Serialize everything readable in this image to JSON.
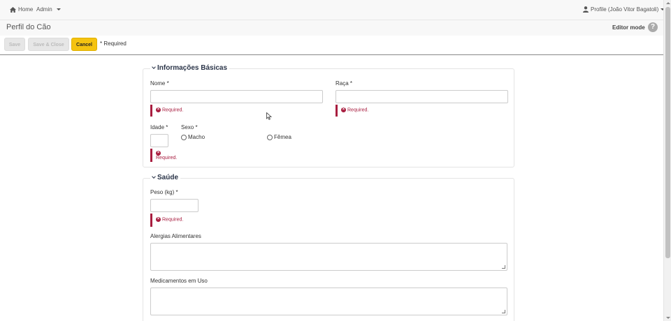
{
  "nav": {
    "home_label": "Home",
    "admin_label": "Admin",
    "profile_label": "Profile (João Vitor Bagatoli)"
  },
  "page": {
    "title": "Perfil do Cão",
    "editor_mode_label": "Editor mode",
    "help_icon": "question-icon"
  },
  "toolbar": {
    "save_label": "Save",
    "save_close_label": "Save & Close",
    "cancel_label": "Cancel",
    "required_note": "* Required"
  },
  "basic_info": {
    "legend": "Informações Básicas",
    "nome_label": "Nome *",
    "nome_value": "",
    "raca_label": "Raça *",
    "raca_value": "",
    "idade_label": "Idade *",
    "idade_value": "",
    "sexo_label": "Sexo *",
    "sexo_options": [
      "Macho",
      "Fêmea"
    ],
    "required_msg": "Required."
  },
  "health": {
    "legend": "Saúde",
    "peso_label": "Peso (kg) *",
    "peso_value": "",
    "alergias_label": "Alergias Alimentares",
    "alergias_value": "",
    "medicamentos_label": "Medicamentos em Uso",
    "medicamentos_value": "",
    "required_msg": "Required."
  },
  "colors": {
    "cancel_button": "#f5c310",
    "error": "#a81d3f",
    "legend_text": "#2a3448"
  }
}
